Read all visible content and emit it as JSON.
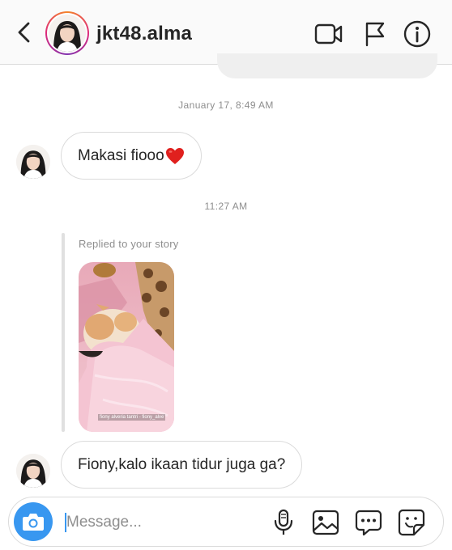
{
  "header": {
    "username": "jkt48.alma",
    "icons": [
      "back-chevron-icon",
      "video-call-icon",
      "flag-icon",
      "info-icon"
    ]
  },
  "messages": [
    {
      "type": "timestamp",
      "text": "January 17, 8:49 AM"
    },
    {
      "type": "received",
      "text": "Makasi fiooo",
      "emoji": "❤️"
    },
    {
      "type": "timestamp",
      "text": "11:27 AM"
    },
    {
      "type": "story_reply",
      "label": "Replied to your story",
      "image_caption": "fiony alveria tantri - fiony_alve"
    },
    {
      "type": "received",
      "text": "Fiony,kalo ikaan tidur juga ga?"
    }
  ],
  "composer": {
    "placeholder": "Message...",
    "value": "",
    "icons": [
      "camera-icon",
      "microphone-icon",
      "gallery-icon",
      "chat-bubble-icon",
      "sticker-icon"
    ],
    "accent_color": "#3897f0"
  },
  "colors": {
    "header_bg": "#fafafa",
    "bubble_border": "#dbdbdb",
    "muted_text": "#8e8e8e",
    "story_ring_start": "#f58529",
    "story_ring_end": "#8134af"
  }
}
